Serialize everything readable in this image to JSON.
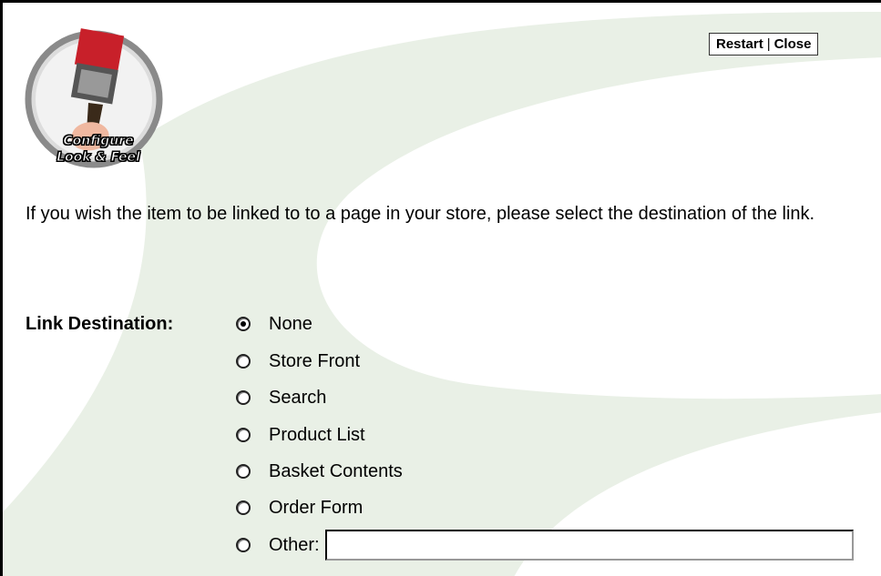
{
  "header": {
    "restart_label": "Restart",
    "separator": "|",
    "close_label": "Close"
  },
  "logo": {
    "line1": "Configure",
    "line2": "Look & Feel",
    "icon": "paintbrush-icon"
  },
  "intro_text": "If you wish the item to be linked to to a page in your store, please select the destination of the link.",
  "link_destination": {
    "label": "Link Destination:",
    "selected": "None",
    "options": [
      {
        "label": "None",
        "checked": true
      },
      {
        "label": "Store Front",
        "checked": false
      },
      {
        "label": "Search",
        "checked": false
      },
      {
        "label": "Product List",
        "checked": false
      },
      {
        "label": "Basket Contents",
        "checked": false
      },
      {
        "label": "Order Form",
        "checked": false
      },
      {
        "label": "Other:",
        "checked": false
      }
    ],
    "other_value": "",
    "other_placeholder": ""
  },
  "colors": {
    "background_swoosh": "#eaf0e6",
    "brush_red": "#c8202a",
    "logo_ring": "#8a8a8a"
  }
}
